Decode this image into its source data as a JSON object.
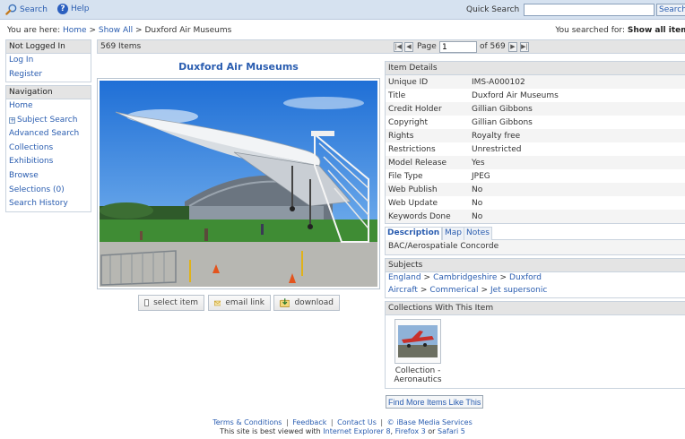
{
  "topbar": {
    "search_label": "Search",
    "help_label": "Help",
    "quick_search_label": "Quick Search",
    "quick_search_value": "",
    "quick_search_button": "Search"
  },
  "breadcrumb": {
    "prefix": "You are here:",
    "items": [
      "Home",
      "Show All",
      "Duxford Air Museums"
    ],
    "separator": ">"
  },
  "searched": {
    "label": "You searched for:",
    "value": "Show all items"
  },
  "account": {
    "header": "Not Logged In",
    "items": [
      "Log In",
      "Register"
    ]
  },
  "navigation": {
    "header": "Navigation",
    "items": [
      "Home",
      "Subject Search",
      "Advanced Search",
      "Collections",
      "Exhibitions",
      "Browse",
      "Selections (0)",
      "Search History"
    ]
  },
  "pager": {
    "count": "569 Items",
    "page_label": "Page",
    "page_value": "1",
    "of_label": "of 569"
  },
  "item": {
    "title": "Duxford Air Museums",
    "actions": [
      "select item",
      "email link",
      "download"
    ]
  },
  "details": {
    "header": "Item Details",
    "rows": [
      {
        "k": "Unique ID",
        "v": "IMS-A000102"
      },
      {
        "k": "Title",
        "v": "Duxford Air Museums"
      },
      {
        "k": "Credit Holder",
        "v": "Gillian Gibbons"
      },
      {
        "k": "Copyright",
        "v": "Gillian Gibbons"
      },
      {
        "k": "Rights",
        "v": "Royalty free"
      },
      {
        "k": "Restrictions",
        "v": "Unrestricted"
      },
      {
        "k": "Model Release",
        "v": "Yes"
      },
      {
        "k": "File Type",
        "v": "JPEG"
      },
      {
        "k": "Web Publish",
        "v": "No"
      },
      {
        "k": "Web Update",
        "v": "No"
      },
      {
        "k": "Keywords Done",
        "v": "No"
      }
    ]
  },
  "tabs": {
    "items": [
      "Description",
      "Map",
      "Notes"
    ],
    "active": "Description",
    "description": "BAC/Aerospatiale Concorde"
  },
  "subjects": {
    "header": "Subjects",
    "row1": [
      "England",
      "Cambridgeshire",
      "Duxford"
    ],
    "row2": [
      "Aircraft",
      "Commerical",
      "Jet supersonic"
    ]
  },
  "collections": {
    "header": "Collections With This Item",
    "caption_line1": "Collection -",
    "caption_line2": "Aeronautics"
  },
  "more_button": "Find More Items Like This",
  "footer": {
    "links": [
      "Terms & Conditions",
      "Feedback",
      "Contact Us",
      "© iBase Media Services"
    ],
    "line2_prefix": "This site is best viewed with",
    "browsers": [
      "Internet Explorer 8",
      "Firefox 3",
      "Safari 5"
    ],
    "or": "or",
    "comma": ","
  },
  "colors": {
    "link": "#2a5db0",
    "topbar_bg": "#d6e2f0",
    "panel_header_bg": "#e4e4e4",
    "border": "#c9d3de"
  },
  "icons": [
    "search-icon",
    "help-icon",
    "checkbox-icon",
    "email-icon",
    "download-icon",
    "first-page-icon",
    "prev-page-icon",
    "next-page-icon",
    "last-page-icon"
  ]
}
